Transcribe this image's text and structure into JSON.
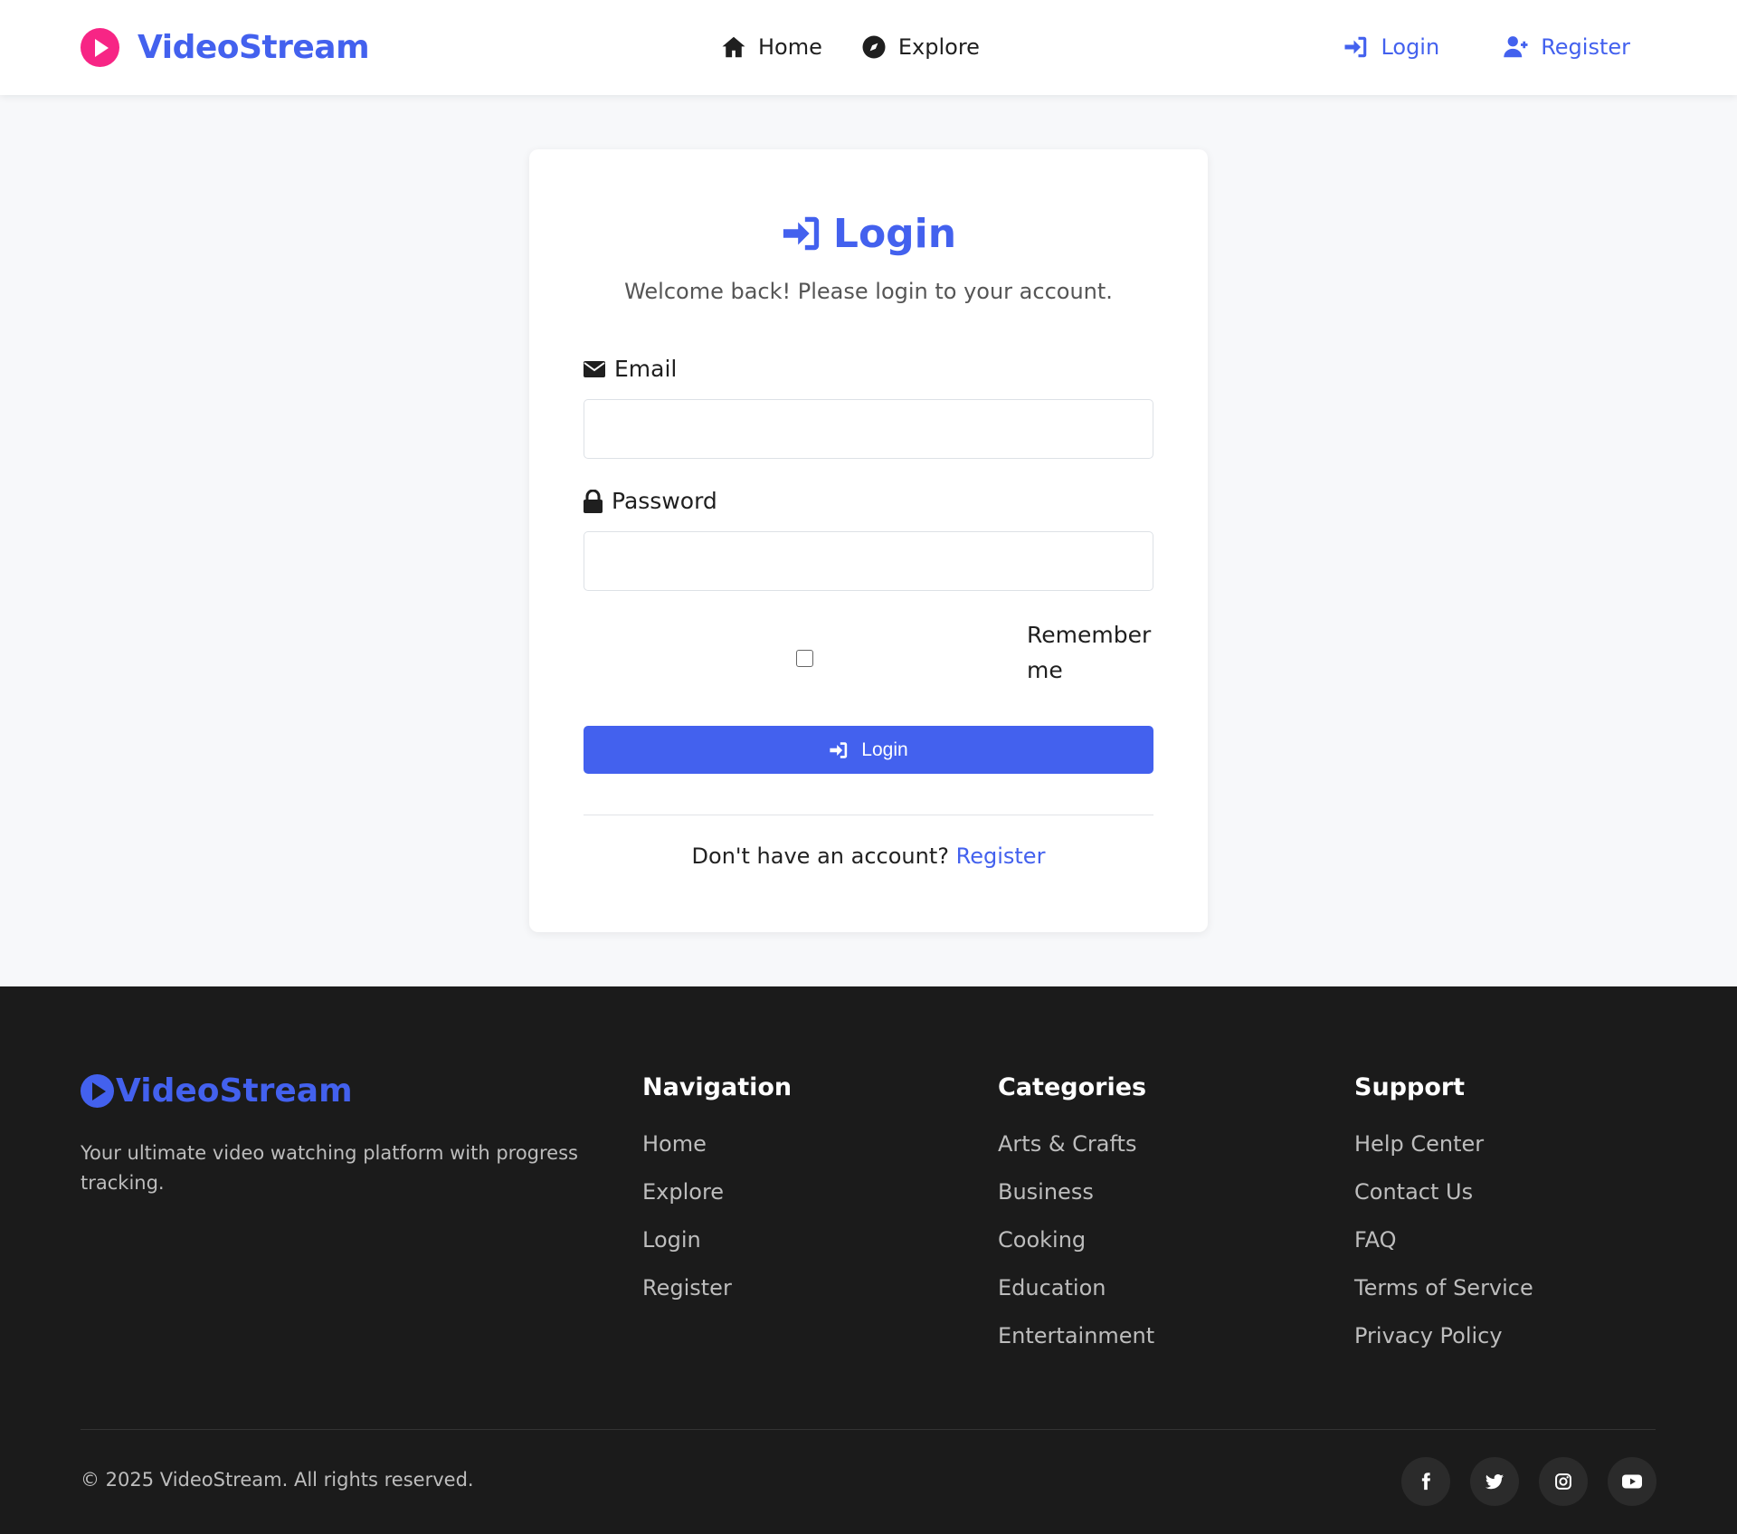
{
  "brand": {
    "name": "VideoStream"
  },
  "nav": {
    "home": "Home",
    "explore": "Explore",
    "login": "Login",
    "register": "Register"
  },
  "login_card": {
    "title": "Login",
    "subtitle": "Welcome back! Please login to your account.",
    "email_label": "Email",
    "email_value": "",
    "password_label": "Password",
    "password_value": "",
    "remember_label": "Remember me",
    "remember_checked": false,
    "submit_label": "Login",
    "no_account_text": "Don't have an account?",
    "register_link": "Register"
  },
  "footer": {
    "brand": "VideoStream",
    "about": "Your ultimate video watching platform with progress tracking.",
    "navigation": {
      "heading": "Navigation",
      "items": [
        "Home",
        "Explore",
        "Login",
        "Register"
      ]
    },
    "categories": {
      "heading": "Categories",
      "items": [
        "Arts & Crafts",
        "Business",
        "Cooking",
        "Education",
        "Entertainment"
      ]
    },
    "support": {
      "heading": "Support",
      "items": [
        "Help Center",
        "Contact Us",
        "FAQ",
        "Terms of Service",
        "Privacy Policy"
      ]
    },
    "copyright": "© 2025 VideoStream. All rights reserved.",
    "socials": [
      "facebook-icon",
      "twitter-icon",
      "instagram-icon",
      "youtube-icon"
    ]
  },
  "colors": {
    "brand_blue": "#4361ee",
    "brand_pink": "#f72585",
    "footer_bg": "#1b1b1b",
    "page_bg": "#f7f8fa"
  }
}
